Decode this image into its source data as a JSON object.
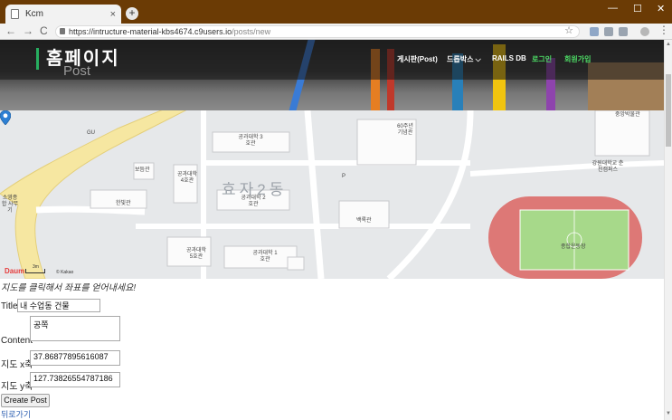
{
  "browser": {
    "tab_title": "Kcm",
    "tab_close": "×",
    "new_tab": "+",
    "url_host": "https://intructure-material-kbs4674.c9users.io",
    "url_path": "/posts/new",
    "back": "←",
    "forward": "→",
    "reload": "C",
    "star": "☆",
    "minimize": "—",
    "maximize": "☐",
    "close": "✕",
    "menu": "⋮"
  },
  "site": {
    "brand": "홈페이지",
    "subtitle": "Post",
    "nav": [
      {
        "label": "게시판(Post)"
      },
      {
        "label": "드롭박스 ⌵"
      },
      {
        "label": "RAILS DB"
      },
      {
        "label": "로그인"
      },
      {
        "label": "회원가입"
      }
    ],
    "accent": "#27ae60"
  },
  "map": {
    "dong": "효자2동",
    "labels": {
      "gu": "GU",
      "jungang": "중앙박물관",
      "boeung": "보듬관",
      "eng4": "공과대학 4호관",
      "eng3": "공과대학 3호관",
      "eng2": "공과대학 2호관",
      "eng1": "공과대학 1호관",
      "eng5": "공과대학 5호관",
      "hanbit": "한빛관",
      "memorial": "60주년 기념관",
      "baekrok": "백록관",
      "kangwon": "강원대학교 춘천캠퍼스",
      "stadium": "종합운동장",
      "office": "소영종합 사무기",
      "p": "P"
    },
    "brand": "Daum",
    "scale": "3m",
    "copyright": "© Kakao"
  },
  "form": {
    "hint": "지도를 클릭해서 좌표를 얻어내세요!",
    "title_label": "Title",
    "title_value": "내 수업동 건물",
    "content_label": "Content",
    "content_value": "공쪽",
    "x_label": "지도 x축",
    "x_value": "37.86877895616087",
    "y_label": "지도 y축",
    "y_value": "127.73826554787186",
    "submit_label": "Create Post",
    "back_link": "뒤로가기"
  }
}
